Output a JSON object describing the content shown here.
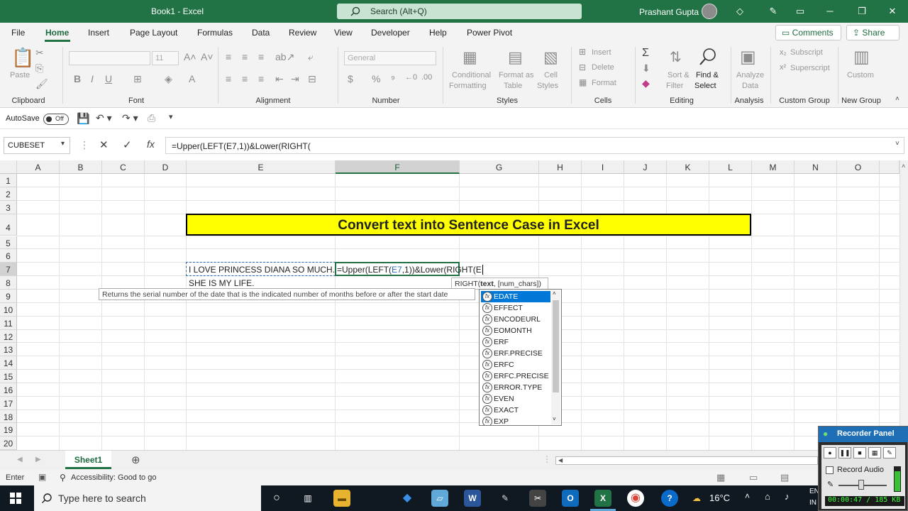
{
  "window": {
    "title": "Book1 - Excel",
    "search_placeholder": "Search (Alt+Q)",
    "user_name": "Prashant Gupta"
  },
  "menu": {
    "tabs": [
      "File",
      "Home",
      "Insert",
      "Page Layout",
      "Formulas",
      "Data",
      "Review",
      "View",
      "Developer",
      "Help",
      "Power Pivot"
    ],
    "active_tab": "Home",
    "comments_label": "Comments",
    "share_label": "Share"
  },
  "ribbon": {
    "clipboard": {
      "label": "Clipboard",
      "paste": "Paste"
    },
    "font": {
      "label": "Font",
      "size": "11"
    },
    "alignment": {
      "label": "Alignment"
    },
    "number": {
      "label": "Number",
      "format": "General"
    },
    "styles": {
      "label": "Styles",
      "conditional": "Conditional",
      "formatting": "Formatting",
      "format_as": "Format as",
      "table": "Table",
      "cell": "Cell",
      "styles": "Styles"
    },
    "cells": {
      "label": "Cells",
      "insert": "Insert",
      "delete": "Delete",
      "format": "Format"
    },
    "editing": {
      "label": "Editing",
      "sort": "Sort &",
      "filter": "Filter",
      "find": "Find &",
      "select": "Select"
    },
    "analysis": {
      "label": "Analysis",
      "analyze": "Analyze",
      "data": "Data"
    },
    "custom_group": {
      "label": "Custom Group",
      "subscript": "Subscript",
      "superscript": "Superscript"
    },
    "new_group": {
      "label": "New Group",
      "custom": "Custom"
    }
  },
  "qat": {
    "autosave": "AutoSave",
    "toggle": "Off"
  },
  "formula_bar": {
    "name_box": "CUBESET",
    "formula": "=Upper(LEFT(E7,1))&Lower(RIGHT("
  },
  "grid": {
    "columns": [
      "A",
      "B",
      "C",
      "D",
      "E",
      "F",
      "G",
      "H",
      "I",
      "J",
      "K",
      "L",
      "M",
      "N",
      "O"
    ],
    "rows": [
      "1",
      "2",
      "3",
      "4",
      "5",
      "6",
      "7",
      "8",
      "9",
      "10",
      "11",
      "12",
      "13",
      "14",
      "15",
      "16",
      "17",
      "18",
      "19",
      "20"
    ],
    "banner": "Convert text into Sentence Case in Excel",
    "e7": "I LOVE PRINCESS DIANA SO MUCH.",
    "e8": "SHE IS MY LIFE.",
    "f7_a": "=Upper(LEFT(",
    "f7_ref": "E7",
    "f7_b": ",1))&Lower(RIGHT(E"
  },
  "tooltips": {
    "description": "Returns the serial number of the date that is the indicated number of months before or after the start date",
    "arg_fn": "RIGHT(",
    "arg_bold": "text",
    "arg_rest": ", [num_chars])"
  },
  "autocomplete": {
    "icon": "fx",
    "items": [
      "EDATE",
      "EFFECT",
      "ENCODEURL",
      "EOMONTH",
      "ERF",
      "ERF.PRECISE",
      "ERFC",
      "ERFC.PRECISE",
      "ERROR.TYPE",
      "EVEN",
      "EXACT",
      "EXP"
    ],
    "selected": "EDATE"
  },
  "sheets": {
    "active": "Sheet1"
  },
  "status": {
    "mode": "Enter",
    "accessibility": "Accessibility: Good to go"
  },
  "taskbar": {
    "search_placeholder": "Type here to search",
    "temperature": "16°C",
    "lang_line1": "EN",
    "lang_line2": "IN"
  },
  "recorder": {
    "title": "Recorder Panel",
    "record_audio": "Record Audio",
    "time": "00:00:47 / 185 KB"
  },
  "colors": {
    "excel_green": "#217346",
    "banner_yellow": "#ffff00",
    "selection_blue": "#0078d7"
  }
}
